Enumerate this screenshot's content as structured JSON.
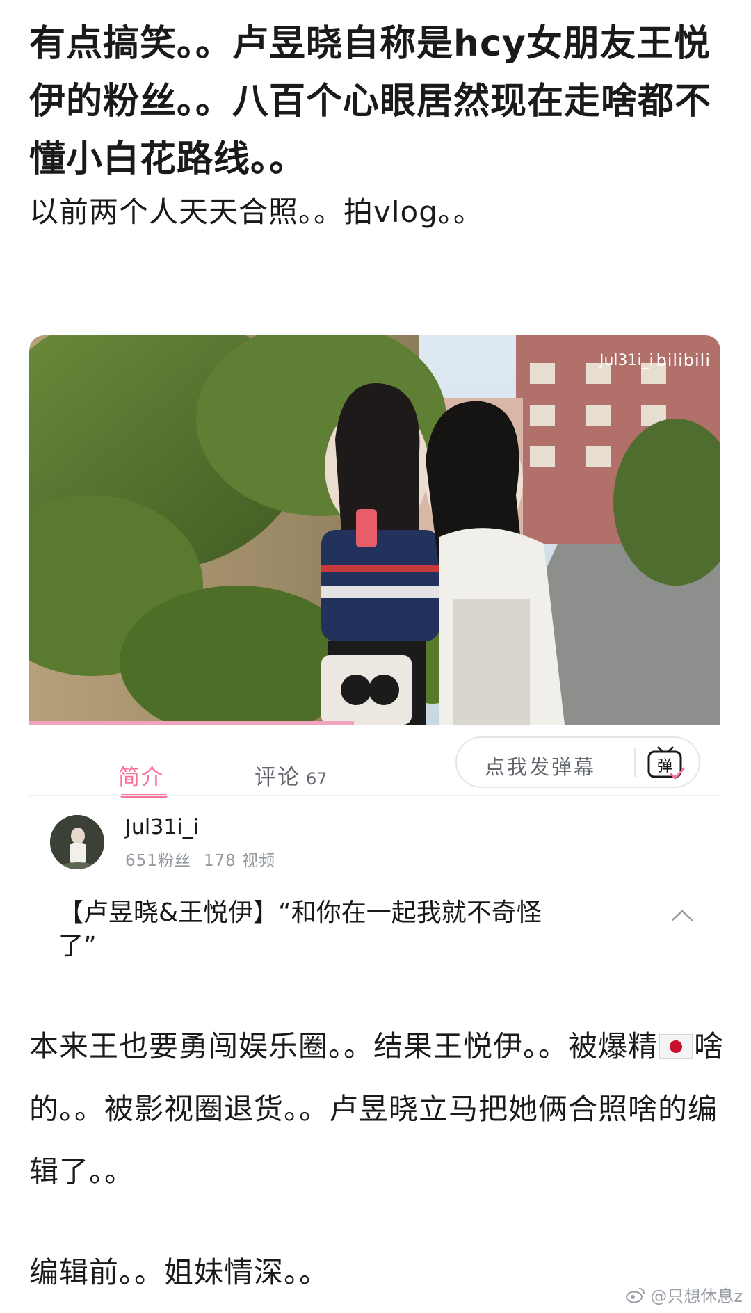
{
  "post": {
    "headline": "有点搞笑。。卢昱晓自称是hcy女朋友王悦伊的粉丝。。八百个心眼居然现在走啥都不懂小白花路线。。",
    "para1": "以前两个人天天合照。。拍vlog。。",
    "para2_part1": "本来王也要勇闯娱乐圈。。结果王悦伊。。被爆精",
    "para2_part2": "啥的。。被影视圈退货。。卢昱晓立马把她俩合照啥的编辑了。。",
    "para3": "编辑前。。姐妹情深。。"
  },
  "video": {
    "watermark_user": "Jul31i_i",
    "watermark_site": "bilibili",
    "progress": 0.47
  },
  "tabs": [
    {
      "label": "简介"
    },
    {
      "label": "评论",
      "count": "67"
    }
  ],
  "danmaku": {
    "placeholder": "点我发弹幕",
    "icon_char": "弹"
  },
  "uploader": {
    "name": "Jul31i_i",
    "fans": "651粉丝",
    "videos": "178 视频"
  },
  "video_title": "【卢昱晓&王悦伊】“和你在一起我就不奇怪了”",
  "source_mark": "@只想休息z",
  "colors": {
    "accent": "#fb7299",
    "muted": "#9499a0"
  }
}
